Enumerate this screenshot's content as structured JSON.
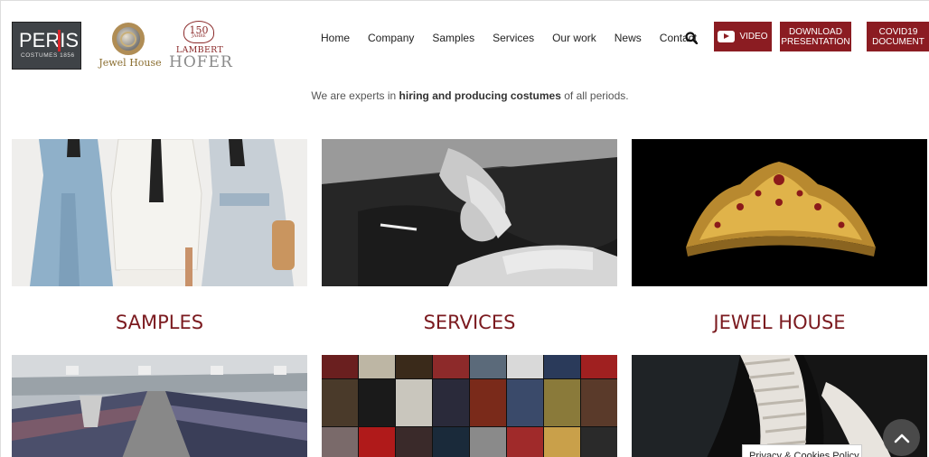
{
  "brand": {
    "peris_big": "PERIS",
    "peris_small": "COSTUMES 1856",
    "jewel_house": "Jewel House",
    "lambert_years": "150",
    "lambert_years_sub": "JAHRE",
    "lambert_line1": "LAMBERT",
    "lambert_line2": "HOFER"
  },
  "nav": {
    "items": [
      "Home",
      "Company",
      "Samples",
      "Services",
      "Our work",
      "News",
      "Contact"
    ]
  },
  "buttons": {
    "video": "VIDEO",
    "download_line1": "DOWNLOAD",
    "download_line2": "PRESENTATION",
    "covid_line1": "COVID19",
    "covid_line2": "DOCUMENT"
  },
  "tagline": {
    "before": "We are experts in ",
    "bold": "hiring and producing costumes",
    "after": " of all periods."
  },
  "tiles": [
    {
      "title": "SAMPLES"
    },
    {
      "title": "SERVICES"
    },
    {
      "title": "JEWEL HOUSE"
    }
  ],
  "cookie": {
    "label": "Privacy & Cookies Policy"
  },
  "colors": {
    "brand_red": "#8b1c22",
    "title_red": "#7b1a1f"
  },
  "icons": {
    "search": "search-icon",
    "scroll_top": "chevron-up-icon",
    "video": "youtube-icon"
  }
}
